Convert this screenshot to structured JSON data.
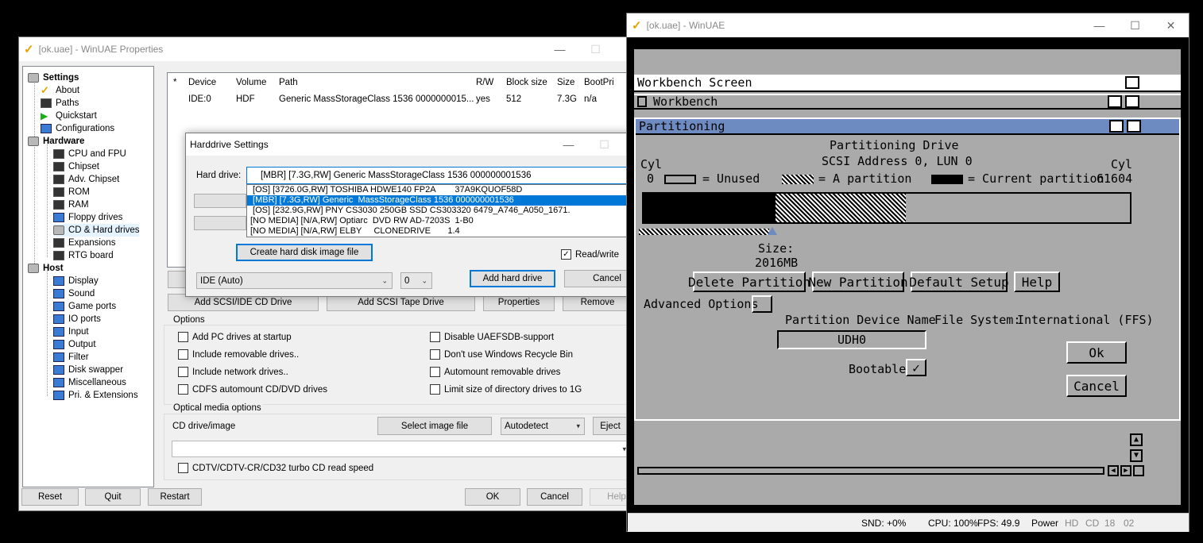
{
  "props": {
    "title": "[ok.uae] - WinUAE Properties",
    "tree": [
      {
        "label": "Settings",
        "bold": true
      },
      {
        "label": "About"
      },
      {
        "label": "Paths"
      },
      {
        "label": "Quickstart"
      },
      {
        "label": "Configurations"
      },
      {
        "label": "Hardware",
        "bold": true
      },
      {
        "label": "CPU and FPU"
      },
      {
        "label": "Chipset"
      },
      {
        "label": "Adv. Chipset"
      },
      {
        "label": "ROM"
      },
      {
        "label": "RAM"
      },
      {
        "label": "Floppy drives"
      },
      {
        "label": "CD & Hard drives"
      },
      {
        "label": "Expansions"
      },
      {
        "label": "RTG board"
      },
      {
        "label": "Host",
        "bold": true
      },
      {
        "label": "Display"
      },
      {
        "label": "Sound"
      },
      {
        "label": "Game ports"
      },
      {
        "label": "IO ports"
      },
      {
        "label": "Input"
      },
      {
        "label": "Output"
      },
      {
        "label": "Filter"
      },
      {
        "label": "Disk swapper"
      },
      {
        "label": "Miscellaneous"
      },
      {
        "label": "Pri. & Extensions"
      }
    ],
    "columns": [
      "*",
      "Device",
      "Volume",
      "Path",
      "R/W",
      "Block size",
      "Size",
      "BootPri"
    ],
    "rows": [
      [
        "",
        "IDE:0",
        "HDF",
        "Generic  MassStorageClass 1536 0000000015...",
        "yes",
        "512",
        "7.3G",
        "n/a"
      ]
    ],
    "buttons": {
      "add_cd": "Add SCSI/IDE CD Drive",
      "add_tape": "Add SCSI Tape Drive",
      "properties": "Properties",
      "remove": "Remove"
    },
    "options_title": "Options",
    "options_left": [
      "Add PC drives at startup",
      "Include removable drives..",
      "Include network drives..",
      "CDFS automount CD/DVD drives"
    ],
    "options_right": [
      "Disable UAEFSDB-support",
      "Don't use Windows Recycle Bin",
      "Automount removable drives",
      "Limit size of directory drives to 1G"
    ],
    "optical_title": "Optical media options",
    "cd_label": "CD drive/image",
    "select_image": "Select image file",
    "autodetect": "Autodetect",
    "eject": "Eject",
    "cdtv_label": "CDTV/CDTV-CR/CD32 turbo CD read speed",
    "footer": {
      "reset": "Reset",
      "quit": "Quit",
      "restart": "Restart",
      "ok": "OK",
      "cancel": "Cancel",
      "help": "Help"
    }
  },
  "hdd": {
    "title": "Harddrive Settings",
    "hard_drive_label": "Hard drive:",
    "selected": "[MBR] [7.3G,RW] Generic  MassStorageClass 1536 000000001536",
    "options": [
      " [OS] [3726.0G,RW] TOSHIBA HDWE140 FP2A        37A9KQUOF58D",
      " [MBR] [7.3G,RW] Generic  MassStorageClass 1536 000000001536",
      " [OS] [232.9G,RW] PNY CS3030 250GB SSD CS303320 6479_A746_A050_1671.",
      "[NO MEDIA] [N/A,RW] Optiarc  DVD RW AD-7203S  1-B0",
      "[NO MEDIA] [N/A,RW] ELBY     CLONEDRIVE       1.4"
    ],
    "create_image": "Create hard disk image file",
    "read_write": "Read/write",
    "controller": "IDE (Auto)",
    "unit": "0",
    "add": "Add hard drive",
    "cancel": "Cancel"
  },
  "winuae": {
    "title": "[ok.uae] - WinUAE",
    "screen_title": "Workbench Screen",
    "wb_title": "Workbench",
    "part_title": "Partitioning",
    "heading": "Partitioning Drive",
    "address": "SCSI Address 0, LUN 0",
    "cyl_left_label": "Cyl",
    "cyl_left_value": "0",
    "cyl_right_label": "Cyl",
    "cyl_right_value": "61604",
    "legend_unused": "= Unused",
    "legend_partition": "= A partition",
    "legend_current": "= Current partition",
    "size_label": "Size:",
    "size_value": "2016MB",
    "btn_delete": "Delete Partition",
    "btn_new": "New Partition",
    "btn_default": "Default Setup",
    "btn_help": "Help",
    "advanced": "Advanced Options",
    "device_name_label": "Partition Device Name",
    "fs_label": "File System:",
    "fs_value": "International (FFS)",
    "device_name": "UDH0",
    "bootable": "Bootable",
    "ok": "Ok",
    "cancel": "Cancel",
    "status": {
      "snd": "SND: +0%",
      "cpu": "CPU: 100%",
      "fps": "FPS: 49.9",
      "power": "Power",
      "hd": "HD",
      "cd": "CD",
      "n18": "18",
      "n02": "02"
    }
  }
}
